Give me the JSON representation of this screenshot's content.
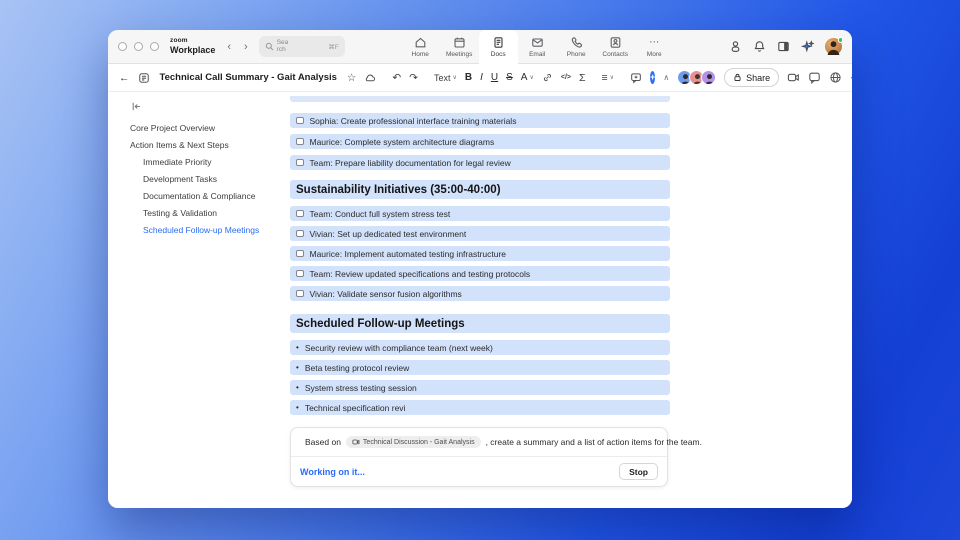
{
  "colors": {
    "accent": "#2a6cf6",
    "row_highlight": "#d2e2fa",
    "desktop_top_left": "#a8c3f4",
    "desktop_bottom_right": "#1440d4"
  },
  "chrome": {
    "logo_top": "zoom",
    "logo_bottom": "Workplace",
    "search": {
      "text_line1": "Sea",
      "text_line2": "rch",
      "shortcut": "⌘F"
    },
    "tabs": [
      {
        "label": "Home"
      },
      {
        "label": "Meetings"
      },
      {
        "label": "Docs",
        "active": true
      },
      {
        "label": "Email"
      },
      {
        "label": "Phone"
      },
      {
        "label": "Contacts"
      },
      {
        "label": "More"
      }
    ]
  },
  "toolbar": {
    "title": "Technical Call Summary - Gait Analysis",
    "text_style": "Text",
    "share": "Share"
  },
  "icons": {
    "back": "←",
    "chevron_left": "‹",
    "chevron_right": "›",
    "star": "☆",
    "undo": "↶",
    "redo": "↷",
    "chevron_down": "∨",
    "bold": "B",
    "italic": "I",
    "underline": "U",
    "strikethrough": "S",
    "text_color": "A",
    "code": "</>",
    "sigma": "Σ",
    "align": "≡",
    "caret_up": "∧",
    "more_dots": "⋯",
    "plus": "+",
    "bullet": "•"
  },
  "sidebar": {
    "items": [
      {
        "label": "Core Project Overview",
        "level": 1
      },
      {
        "label": "Action Items & Next Steps",
        "level": 1
      },
      {
        "label": "Immediate Priority",
        "level": 2
      },
      {
        "label": "Development Tasks",
        "level": 2
      },
      {
        "label": "Documentation & Compliance",
        "level": 2
      },
      {
        "label": "Testing & Validation",
        "level": 2
      },
      {
        "label": "Scheduled Follow-up Meetings",
        "level": 2,
        "active": true
      }
    ]
  },
  "content": {
    "checklist_top": [
      {
        "text": "Sophia: Create professional interface training materials",
        "checked": false
      },
      {
        "text": "Maurice: Complete system architecture diagrams",
        "checked": false
      },
      {
        "text": "Team: Prepare liability documentation for legal review",
        "checked": false
      }
    ],
    "section1": {
      "heading": "Sustainability Initiatives (35:00-40:00)",
      "items": [
        {
          "text": "Team: Conduct full system stress test",
          "checked": false
        },
        {
          "text": "Vivian: Set up dedicated test environment",
          "checked": false
        },
        {
          "text": "Maurice: Implement automated testing infrastructure",
          "checked": false
        },
        {
          "text": "Team: Review updated specifications and testing protocols",
          "checked": false
        },
        {
          "text": "Vivian: Validate sensor fusion algorithms",
          "checked": false
        }
      ]
    },
    "section2": {
      "heading": "Scheduled Follow-up Meetings",
      "items": [
        "Security review with compliance team (next week)",
        "Beta testing protocol review",
        "System stress testing session",
        "Technical specification revi"
      ]
    },
    "ai_panel": {
      "prefix": "Based on",
      "source_chip": "Technical Discussion - Gait Analysis",
      "suffix": ", create a summary and a list of action items for the team.",
      "status": "Working on it...",
      "stop": "Stop"
    }
  }
}
